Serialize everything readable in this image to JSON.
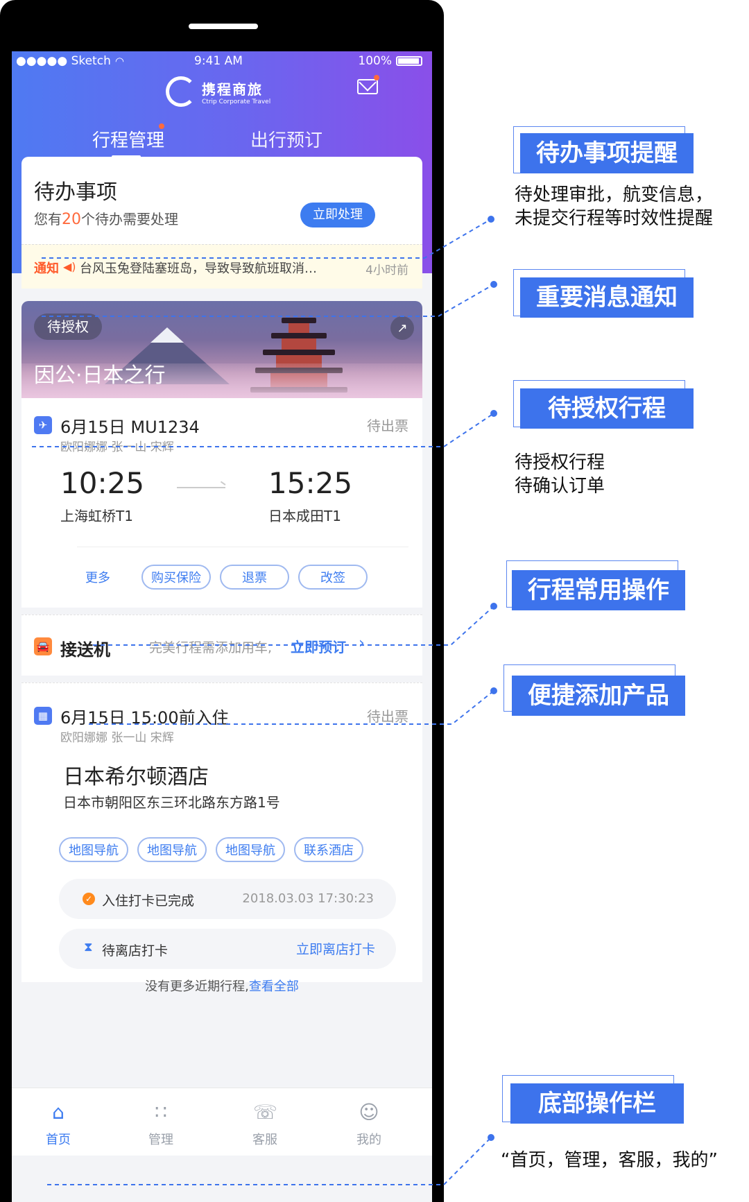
{
  "status_bar": {
    "carrier": "●●●●● Sketch",
    "time": "9:41 AM",
    "battery": "100%"
  },
  "header": {
    "logo_cn": "携程商旅",
    "logo_en": "Ctrip Corporate Travel",
    "tabs": [
      {
        "label": "行程管理"
      },
      {
        "label": "出行预订"
      }
    ]
  },
  "todo": {
    "title": "待办事项",
    "sub_prefix": "您有",
    "count": "20",
    "sub_suffix": "个待办需要处理",
    "button": "立即处理"
  },
  "notice": {
    "label": "通知",
    "text": "台风玉兔登陆塞班岛，导致导致航班取消…",
    "time": "4小时前"
  },
  "trip": {
    "status": "待授权",
    "name": "因公·日本之行"
  },
  "flight": {
    "header": "6月15日  MU1234",
    "status": "待出票",
    "passengers": "欧阳娜娜   张一山   宋辉",
    "dep_time": "10:25",
    "dep_place": "上海虹桥T1",
    "arr_time": "15:25",
    "arr_place": "日本成田T1",
    "ops": [
      "更多",
      "购买保险",
      "退票",
      "改签"
    ]
  },
  "transfer": {
    "title": "接送机",
    "hint": "完美行程需添加用车,",
    "link": "立即预订"
  },
  "hotel": {
    "header": "6月15日  15:00前入住",
    "status": "待出票",
    "passengers": "欧阳娜娜   张一山   宋辉",
    "name": "日本希尔顿酒店",
    "address": "日本市朝阳区东三环北路东方路1号",
    "ops": [
      "地图导航",
      "地图导航",
      "地图导航",
      "联系酒店"
    ],
    "checkin_label": "入住打卡已完成",
    "checkin_time": "2018.03.03 17:30:23",
    "checkout_label": "待离店打卡",
    "checkout_link": "立即离店打卡"
  },
  "more": {
    "text": "没有更多近期行程,",
    "link": "查看全部"
  },
  "tabbar": [
    {
      "label": "首页",
      "icon": "home-icon"
    },
    {
      "label": "管理",
      "icon": "grid-icon"
    },
    {
      "label": "客服",
      "icon": "support-icon"
    },
    {
      "label": "我的",
      "icon": "profile-icon"
    }
  ],
  "callouts": [
    {
      "title": "待办事项提醒",
      "desc_1": "待处理审批，航变信息，",
      "desc_2": "未提交行程等时效性提醒"
    },
    {
      "title": "重要消息通知"
    },
    {
      "title": "待授权行程",
      "desc_1": "待授权行程",
      "desc_2": "待确认订单"
    },
    {
      "title": "行程常用操作"
    },
    {
      "title": "便捷添加产品"
    },
    {
      "title": "底部操作栏",
      "desc_1": "“首页，管理，客服，我的”"
    }
  ],
  "colors": {
    "primary": "#3d7cf0",
    "accent": "#ff6a3d",
    "callout": "#3d73ec"
  }
}
